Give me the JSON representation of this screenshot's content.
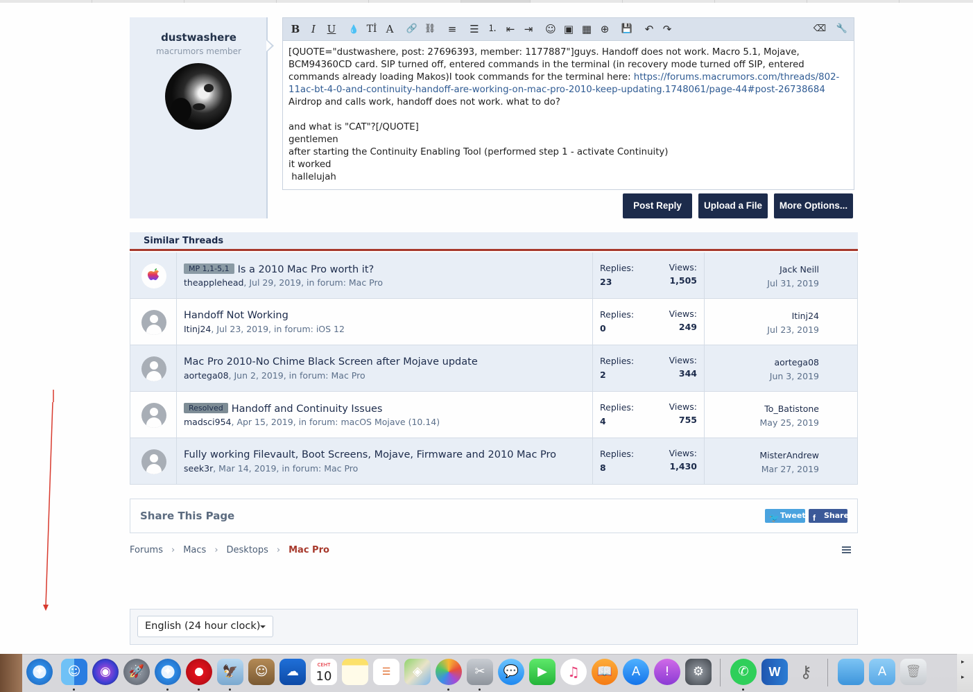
{
  "user": {
    "name": "dustwashere",
    "title": "macrumors member"
  },
  "editor": {
    "text_before_link": "[QUOTE=\"dustwashere, post: 27696393, member: 1177887\"]guys. Handoff does not work. Macro 5.1, Mojave, BCM94360CD card. SIP turned off, entered commands in the terminal (in recovery mode turned off SIP, entered commands already loading Makos)I took commands for the terminal here: ",
    "link": "https://forums.macrumors.com/threads/802-11ac-bt-4-0-and-continuity-handoff-are-working-on-mac-pro-2010-keep-updating.1748061/page-44#post-26738684",
    "text_after_link": "\nAirdrop and calls work, handoff does not work. what to do?\n\nand what is \"CAT\"?[/QUOTE]\ngentlemen\nafter starting the Continuity Enabling Tool (performed step 1 - activate Continuity)\nit worked\n hallelujah",
    "toolbar": [
      "B",
      "I",
      "U",
      "💧",
      "Tİ",
      "A",
      "🔗",
      "⛓",
      "≡",
      "☰",
      "⒈",
      "⇤",
      "⇥",
      "☺",
      "▣",
      "▦",
      "⊕",
      "💾",
      "↶",
      "↷",
      "⌫",
      "🔧"
    ]
  },
  "buttons": {
    "post_reply": "Post Reply",
    "upload": "Upload a File",
    "more": "More Options..."
  },
  "similar": {
    "heading": "Similar Threads",
    "replies_label": "Replies:",
    "views_label": "Views:",
    "threads": [
      {
        "badge": "MP 1,1-5,1",
        "title": "Is a 2010 Mac Pro worth it?",
        "author": "theapplehead",
        "meta": ", Jul 29, 2019, in forum: Mac Pro",
        "replies": "23",
        "views": "1,505",
        "last_user": "Jack Neill",
        "last_date": "Jul 31, 2019"
      },
      {
        "badge": "",
        "title": "Handoff Not Working",
        "author": "Itinj24",
        "meta": ", Jul 23, 2019, in forum: iOS 12",
        "replies": "0",
        "views": "249",
        "last_user": "Itinj24",
        "last_date": "Jul 23, 2019"
      },
      {
        "badge": "",
        "title": "Mac Pro 2010-No Chime Black Screen after Mojave update",
        "author": "aortega08",
        "meta": ", Jun 2, 2019, in forum: Mac Pro",
        "replies": "2",
        "views": "344",
        "last_user": "aortega08",
        "last_date": "Jun 3, 2019"
      },
      {
        "badge": "Resolved",
        "title": "Handoff and Continuity Issues",
        "author": "madsci954",
        "meta": ", Apr 15, 2019, in forum: macOS Mojave (10.14)",
        "replies": "4",
        "views": "755",
        "last_user": "To_Batistone",
        "last_date": "May 25, 2019"
      },
      {
        "badge": "",
        "title": "Fully working Filevault, Boot Screens, Mojave, Firmware and 2010 Mac Pro",
        "author": "seek3r",
        "meta": ", Mar 14, 2019, in forum: Mac Pro",
        "replies": "8",
        "views": "1,430",
        "last_user": "MisterAndrew",
        "last_date": "Mar 27, 2019"
      }
    ]
  },
  "share": {
    "title": "Share This Page",
    "tweet": "Tweet",
    "fb": "Share"
  },
  "breadcrumb": [
    "Forums",
    "Macs",
    "Desktops",
    "Mac Pro"
  ],
  "language": {
    "selected": "English (24 hour clock)"
  },
  "dock": {
    "calendar_month": "СЕНТ",
    "calendar_day": "10"
  },
  "colors": {
    "navy": "#1c2b4b",
    "accent_red": "#a7392c",
    "row_alt": "#e8eef6",
    "twitter": "#4aa3df",
    "facebook": "#3b5998"
  }
}
